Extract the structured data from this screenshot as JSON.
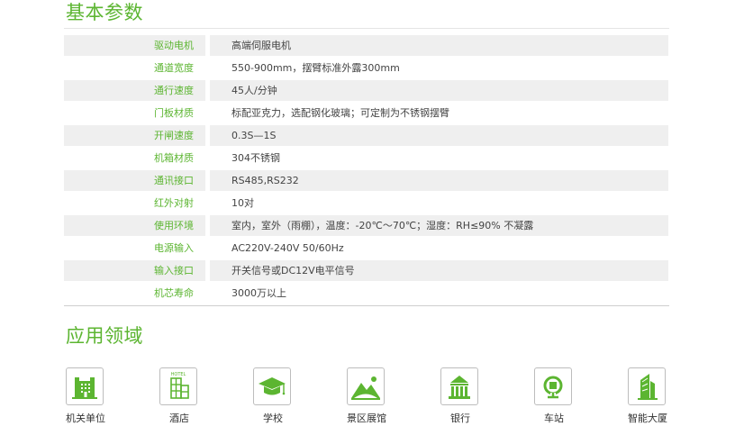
{
  "params": {
    "title": "基本参数",
    "rows": [
      {
        "label": "驱动电机",
        "value": "高端伺服电机"
      },
      {
        "label": "通道宽度",
        "value": "550-900mm，摆臂标准外露300mm"
      },
      {
        "label": "通行速度",
        "value": "45人/分钟"
      },
      {
        "label": "门板材质",
        "value": "标配亚克力，选配钢化玻璃；可定制为不锈钢摆臂"
      },
      {
        "label": "开闸速度",
        "value": "0.3S—1S"
      },
      {
        "label": "机箱材质",
        "value": "304不锈钢"
      },
      {
        "label": "通讯接口",
        "value": "RS485,RS232"
      },
      {
        "label": "红外对射",
        "value": "10对"
      },
      {
        "label": "使用环境",
        "value": "室内，室外（雨棚），温度：-20℃～70℃；湿度：RH≤90% 不凝露"
      },
      {
        "label": "电源输入",
        "value": " AC220V-240V  50/60Hz"
      },
      {
        "label": "输入接口",
        "value": "开关信号或DC12V电平信号"
      },
      {
        "label": "机芯寿命",
        "value": "3000万以上"
      }
    ]
  },
  "applications": {
    "title": "应用领域",
    "items": [
      {
        "label": "机关单位",
        "icon": "government-building-icon",
        "icon_text": ""
      },
      {
        "label": "酒店",
        "icon": "hotel-icon",
        "icon_text": "HOTEL"
      },
      {
        "label": "学校",
        "icon": "graduation-cap-icon",
        "icon_text": ""
      },
      {
        "label": "景区展馆",
        "icon": "scenic-mountain-icon",
        "icon_text": ""
      },
      {
        "label": "银行",
        "icon": "bank-icon",
        "icon_text": ""
      },
      {
        "label": "车站",
        "icon": "railway-station-icon",
        "icon_text": ""
      },
      {
        "label": "智能大厦",
        "icon": "skyscraper-icon",
        "icon_text": ""
      }
    ]
  },
  "colors": {
    "accent": "#5cb531",
    "row_shade": "#efefef",
    "icon_border": "#bdbdbd"
  }
}
